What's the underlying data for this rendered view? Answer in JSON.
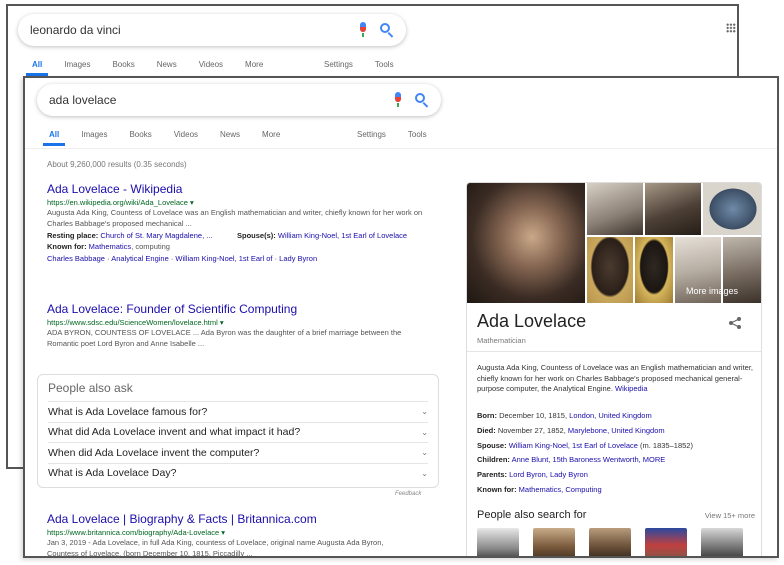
{
  "back_window": {
    "query": "leonardo da vinci",
    "tabs": [
      "All",
      "Images",
      "Books",
      "News",
      "Videos",
      "More"
    ],
    "tools": [
      "Settings",
      "Tools"
    ]
  },
  "front_window": {
    "query": "ada lovelace",
    "tabs": [
      "All",
      "Images",
      "Books",
      "Videos",
      "News",
      "More"
    ],
    "tools": [
      "Settings",
      "Tools"
    ],
    "stats": "About 9,260,000 results (0.35 seconds)",
    "results": [
      {
        "title": "Ada Lovelace - Wikipedia",
        "url": "https://en.wikipedia.org/wiki/Ada_Lovelace",
        "snippet": "Augusta Ada King, Countess of Lovelace was an English mathematician and writer, chiefly known for her work on Charles Babbage's proposed mechanical ...",
        "facts_left": {
          "label": "Resting place:",
          "value": "Church of St. Mary Magdalene, ..."
        },
        "facts_right": {
          "label": "Spouse(s):",
          "value": "William King-Noel, 1st Earl of Lovelace"
        },
        "known_for": {
          "label": "Known for:",
          "value": "Mathematics",
          "rest": ", computing"
        },
        "sitelinks": "Charles Babbage · Analytical Engine · William King-Noel, 1st Earl of · Lady Byron"
      },
      {
        "title": "Ada Lovelace: Founder of Scientific Computing",
        "url": "https://www.sdsc.edu/ScienceWomen/lovelace.html",
        "snippet": "ADA BYRON, COUNTESS OF LOVELACE ... Ada Byron was the daughter of a brief marriage between the Romantic poet Lord Byron and Anne Isabelle ..."
      }
    ],
    "paa": {
      "heading": "People also ask",
      "questions": [
        "What is Ada Lovelace famous for?",
        "What did Ada Lovelace invent and what impact it had?",
        "When did Ada Lovelace invent the computer?",
        "What is Ada Lovelace Day?"
      ],
      "feedback": "Feedback"
    },
    "result_bottom": {
      "title": "Ada Lovelace | Biography & Facts | Britannica.com",
      "url": "https://www.britannica.com/biography/Ada-Lovelace",
      "snippet": "Jan 3, 2019 - Ada Lovelace, in full Ada King, countess of Lovelace, original name Augusta Ada Byron,",
      "snippet2": "Countess of Lovelace, (born December 10, 1815, Piccadilly ..."
    },
    "knowledge_panel": {
      "name": "Ada Lovelace",
      "subtitle": "Mathematician",
      "more_images": "More images",
      "description": "Augusta Ada King, Countess of Lovelace was an English mathematician and writer, chiefly known for her work on Charles Babbage's proposed mechanical general-purpose computer, the Analytical Engine.",
      "description_link": "Wikipedia",
      "facts": [
        {
          "label": "Born:",
          "value": "December 10, 1815,",
          "link": "London, United Kingdom",
          "tail": ""
        },
        {
          "label": "Died:",
          "value": "November 27, 1852,",
          "link": "Marylebone, United Kingdom",
          "tail": ""
        },
        {
          "label": "Spouse:",
          "value": "",
          "link": "William King-Noel, 1st Earl of Lovelace",
          "tail": "(m. 1835–1852)"
        },
        {
          "label": "Children:",
          "value": "",
          "link": "Anne Blunt, 15th Baroness Wentworth, MORE",
          "tail": ""
        },
        {
          "label": "Parents:",
          "value": "",
          "link": "Lord Byron, Lady Byron",
          "tail": ""
        },
        {
          "label": "Known for:",
          "value": "",
          "link": "Mathematics, Computing",
          "tail": ""
        }
      ],
      "people_also_search": "People also search for",
      "view_more": "View 15+ more"
    }
  },
  "colors": {
    "link": "#1a0dab",
    "url_green": "#006621",
    "accent_blue": "#1a73e8"
  }
}
